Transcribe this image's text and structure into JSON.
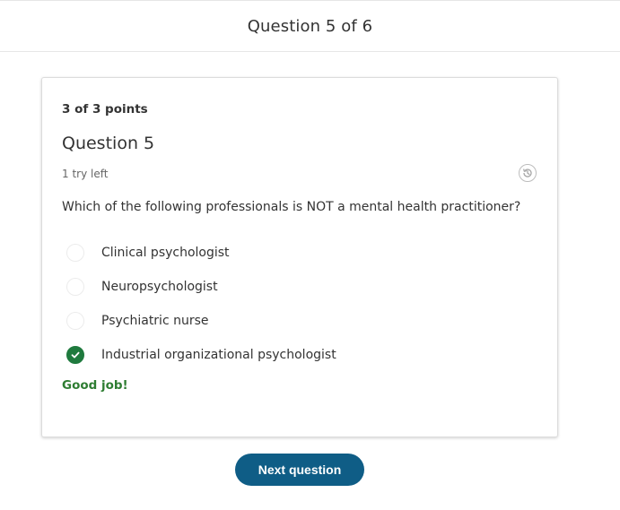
{
  "header": {
    "title": "Question 5 of 6"
  },
  "card": {
    "points": "3 of 3 points",
    "question_title": "Question 5",
    "tries_left": "1 try left",
    "prompt": "Which of the following professionals is NOT a mental health practitioner?",
    "history_icon": "history-icon",
    "options": [
      {
        "label": "Clinical psychologist",
        "selected": false
      },
      {
        "label": "Neuropsychologist",
        "selected": false
      },
      {
        "label": "Psychiatric nurse",
        "selected": false
      },
      {
        "label": "Industrial organizational psychologist",
        "selected": true
      }
    ],
    "feedback": "Good job!"
  },
  "footer": {
    "next_label": "Next question"
  },
  "colors": {
    "accent": "#0f5d86",
    "success": "#1f7a3e",
    "feedback_text": "#2e7d32"
  }
}
